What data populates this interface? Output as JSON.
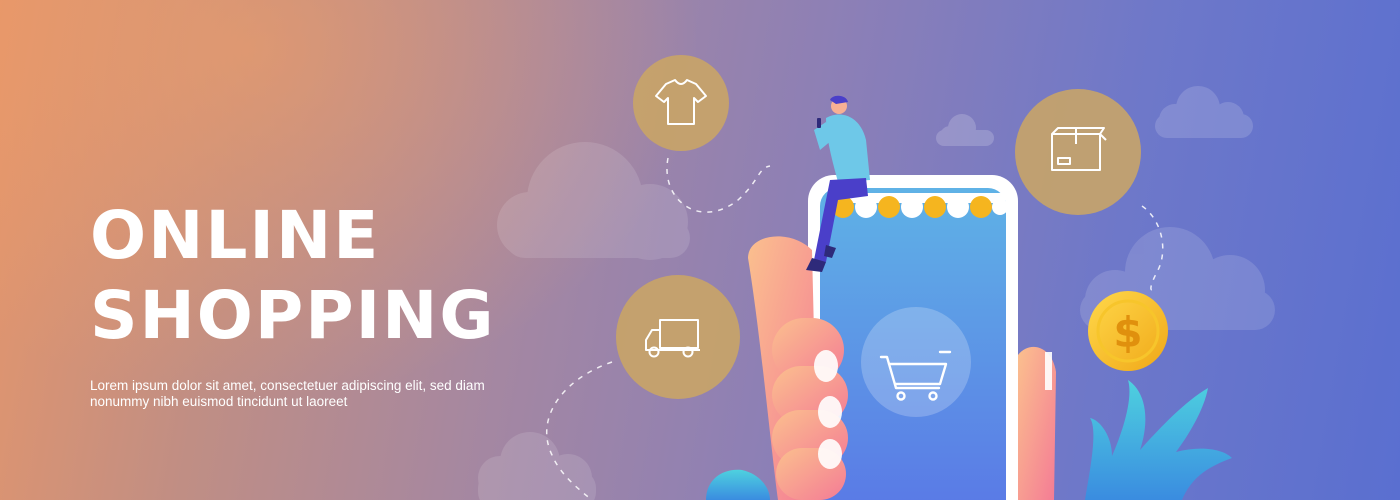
{
  "headline": {
    "line1": "ONLINE",
    "line2": "SHOPPING"
  },
  "body_text": "Lorem ipsum dolor sit amet, consectetuer adipiscing elit, sed diam nonummy nibh euismod tincidunt ut laoreet",
  "currency_symbol": "$",
  "icons": [
    "tshirt-icon",
    "delivery-truck-icon",
    "package-box-icon",
    "dollar-coin-icon",
    "shopping-cart-icon"
  ],
  "colors": {
    "gradient_start": "#e5966b",
    "gradient_end": "#5a6fd0",
    "icon_circle": "#c8a468",
    "coin": "#f2c01f",
    "phone_screen": "#5fa3e6",
    "awning_yellow": "#f5b51f",
    "hand": "#f7a58e",
    "plant": "#53c5e0"
  }
}
